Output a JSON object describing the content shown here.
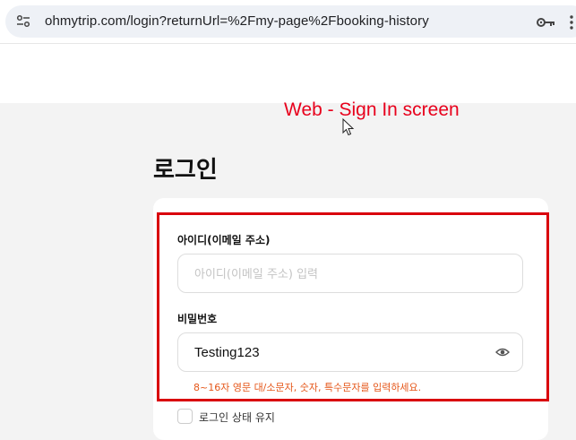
{
  "browser": {
    "url": "ohmytrip.com/login?returnUrl=%2Fmy-page%2Fbooking-history",
    "icons": [
      "site-info-icon",
      "key-icon",
      "overflow-menu-icon"
    ]
  },
  "annotation": {
    "text": "Web - Sign In screen",
    "color": "#e8001c"
  },
  "login": {
    "title": "로그인",
    "id_field": {
      "label": "아이디(이메일 주소)",
      "value": "",
      "placeholder": "아이디(이메일 주소) 입력"
    },
    "password_field": {
      "label": "비밀번호",
      "value": "Testing123"
    },
    "password_hint": "8~16자 영문 대/소문자, 숫자, 특수문자를 입력하세요.",
    "remember_label": "로그인 상태 유지"
  },
  "colors": {
    "highlight": "#d9000d",
    "hint": "#e5571a"
  }
}
